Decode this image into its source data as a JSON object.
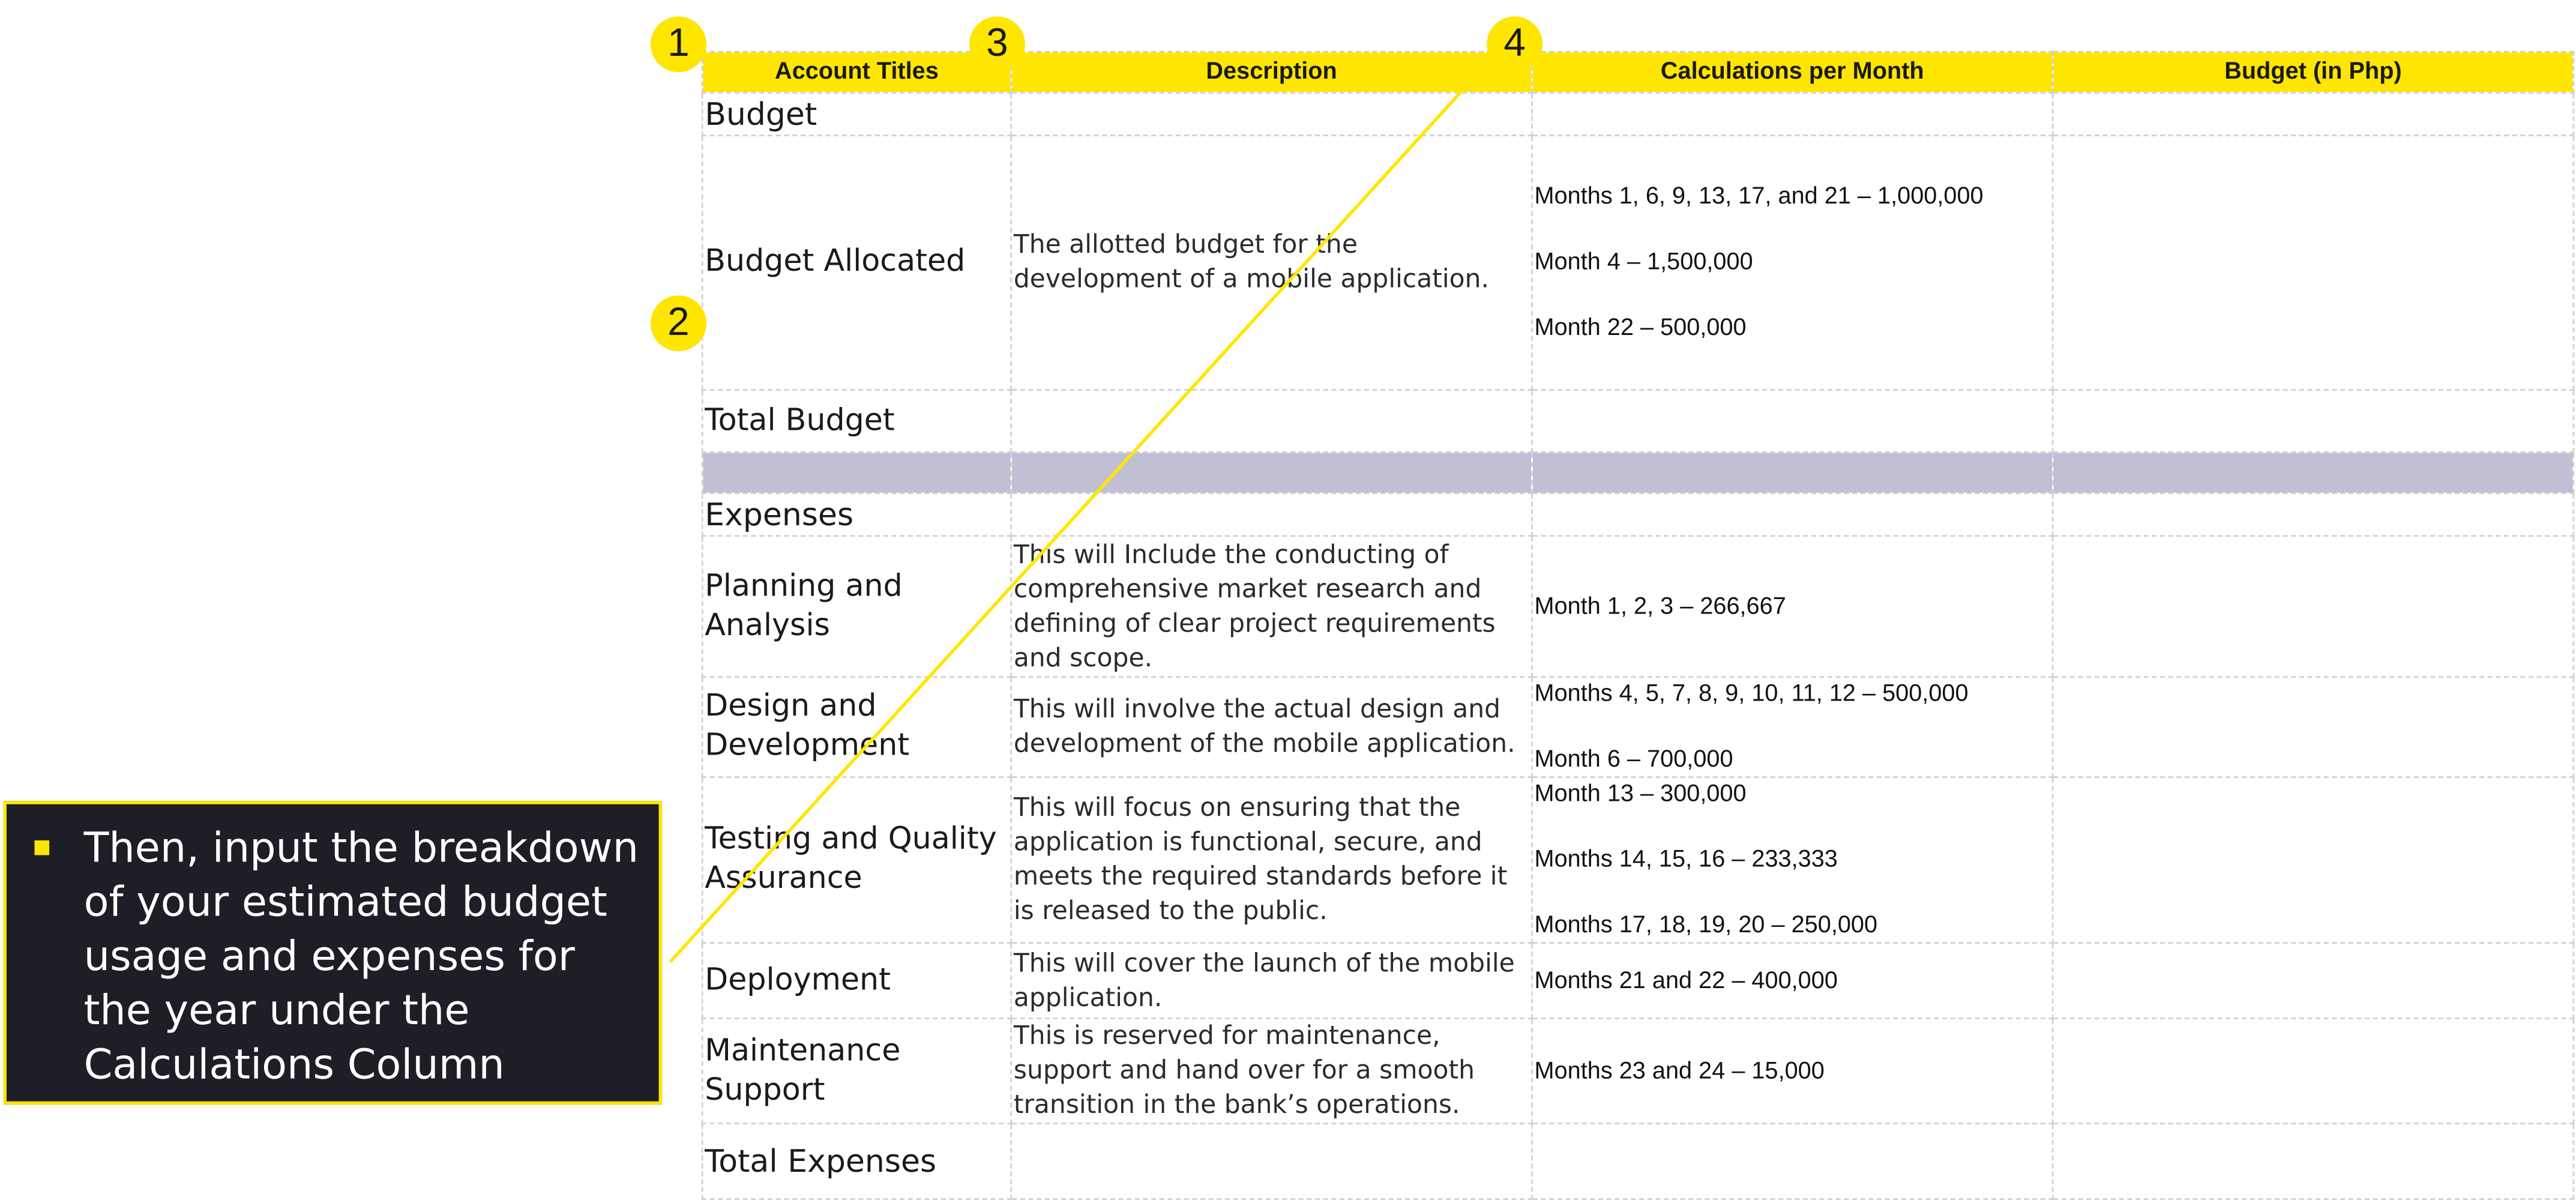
{
  "table": {
    "headers": [
      "Account Titles",
      "Description",
      "Calculations per Month",
      "Budget (in Php)"
    ],
    "budget_section": "Budget",
    "budget_allocated": {
      "title": "Budget Allocated",
      "description": "The allotted budget for the development of a mobile application.",
      "calculations": [
        "Months 1, 6, 9, 13, 17, and 21 – 1,000,000",
        "Month 4 – 1,500,000",
        "Month 22 – 500,000"
      ]
    },
    "total_budget": "Total Budget",
    "expenses_section": "Expenses",
    "planning": {
      "title": "Planning and Analysis",
      "description": "This will Include the conducting of comprehensive market research and defining of clear project requirements and scope.",
      "calculations": [
        "Month 1, 2,  3 – 266,667"
      ]
    },
    "design": {
      "title": "Design and Development",
      "description": "This will involve the actual design and development of the mobile application.",
      "calculations": [
        "Months 4, 5, 7, 8, 9, 10, 11, 12 – 500,000",
        "Month 6 – 700,000"
      ]
    },
    "testing": {
      "title": "Testing and Quality Assurance",
      "description": "This will focus on ensuring that the application is functional, secure, and meets the required standards before it is released to the public.",
      "calculations": [
        "Month 13 – 300,000",
        "Months 14, 15, 16 – 233,333",
        "Months 17, 18, 19, 20 – 250,000"
      ]
    },
    "deployment": {
      "title": "Deployment",
      "description": "This will cover the launch of the mobile application.",
      "calculations": [
        "Months 21 and 22 – 400,000"
      ]
    },
    "maintenance": {
      "title": "Maintenance Support",
      "description": "This is reserved for maintenance, support and hand over for a smooth transition in the bank’s operations.",
      "calculations": [
        "Months 23 and 24 – 15,000"
      ]
    },
    "total_expenses": "Total Expenses"
  },
  "callout": {
    "text": "Then, input the breakdown of your estimated budget usage and expenses for the year under the Calculations Column"
  },
  "markers": [
    "1",
    "2",
    "3",
    "4"
  ],
  "colors": {
    "accent": "#ffe600",
    "callout_bg": "#1e1e26",
    "separator": "#c0bfd4"
  }
}
